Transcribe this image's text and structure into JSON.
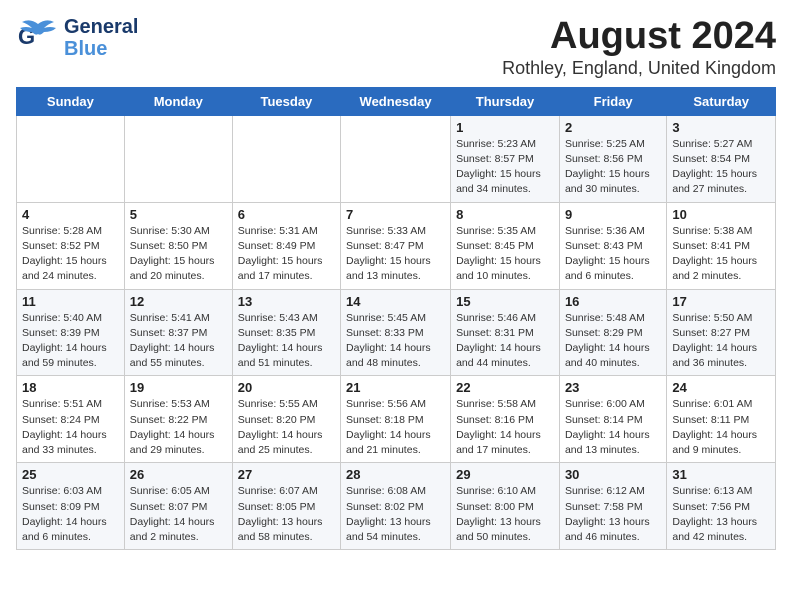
{
  "header": {
    "logo_line1": "General",
    "logo_line2": "Blue",
    "title": "August 2024",
    "subtitle": "Rothley, England, United Kingdom"
  },
  "weekdays": [
    "Sunday",
    "Monday",
    "Tuesday",
    "Wednesday",
    "Thursday",
    "Friday",
    "Saturday"
  ],
  "weeks": [
    [
      {
        "day": "",
        "info": ""
      },
      {
        "day": "",
        "info": ""
      },
      {
        "day": "",
        "info": ""
      },
      {
        "day": "",
        "info": ""
      },
      {
        "day": "1",
        "info": "Sunrise: 5:23 AM\nSunset: 8:57 PM\nDaylight: 15 hours\nand 34 minutes."
      },
      {
        "day": "2",
        "info": "Sunrise: 5:25 AM\nSunset: 8:56 PM\nDaylight: 15 hours\nand 30 minutes."
      },
      {
        "day": "3",
        "info": "Sunrise: 5:27 AM\nSunset: 8:54 PM\nDaylight: 15 hours\nand 27 minutes."
      }
    ],
    [
      {
        "day": "4",
        "info": "Sunrise: 5:28 AM\nSunset: 8:52 PM\nDaylight: 15 hours\nand 24 minutes."
      },
      {
        "day": "5",
        "info": "Sunrise: 5:30 AM\nSunset: 8:50 PM\nDaylight: 15 hours\nand 20 minutes."
      },
      {
        "day": "6",
        "info": "Sunrise: 5:31 AM\nSunset: 8:49 PM\nDaylight: 15 hours\nand 17 minutes."
      },
      {
        "day": "7",
        "info": "Sunrise: 5:33 AM\nSunset: 8:47 PM\nDaylight: 15 hours\nand 13 minutes."
      },
      {
        "day": "8",
        "info": "Sunrise: 5:35 AM\nSunset: 8:45 PM\nDaylight: 15 hours\nand 10 minutes."
      },
      {
        "day": "9",
        "info": "Sunrise: 5:36 AM\nSunset: 8:43 PM\nDaylight: 15 hours\nand 6 minutes."
      },
      {
        "day": "10",
        "info": "Sunrise: 5:38 AM\nSunset: 8:41 PM\nDaylight: 15 hours\nand 2 minutes."
      }
    ],
    [
      {
        "day": "11",
        "info": "Sunrise: 5:40 AM\nSunset: 8:39 PM\nDaylight: 14 hours\nand 59 minutes."
      },
      {
        "day": "12",
        "info": "Sunrise: 5:41 AM\nSunset: 8:37 PM\nDaylight: 14 hours\nand 55 minutes."
      },
      {
        "day": "13",
        "info": "Sunrise: 5:43 AM\nSunset: 8:35 PM\nDaylight: 14 hours\nand 51 minutes."
      },
      {
        "day": "14",
        "info": "Sunrise: 5:45 AM\nSunset: 8:33 PM\nDaylight: 14 hours\nand 48 minutes."
      },
      {
        "day": "15",
        "info": "Sunrise: 5:46 AM\nSunset: 8:31 PM\nDaylight: 14 hours\nand 44 minutes."
      },
      {
        "day": "16",
        "info": "Sunrise: 5:48 AM\nSunset: 8:29 PM\nDaylight: 14 hours\nand 40 minutes."
      },
      {
        "day": "17",
        "info": "Sunrise: 5:50 AM\nSunset: 8:27 PM\nDaylight: 14 hours\nand 36 minutes."
      }
    ],
    [
      {
        "day": "18",
        "info": "Sunrise: 5:51 AM\nSunset: 8:24 PM\nDaylight: 14 hours\nand 33 minutes."
      },
      {
        "day": "19",
        "info": "Sunrise: 5:53 AM\nSunset: 8:22 PM\nDaylight: 14 hours\nand 29 minutes."
      },
      {
        "day": "20",
        "info": "Sunrise: 5:55 AM\nSunset: 8:20 PM\nDaylight: 14 hours\nand 25 minutes."
      },
      {
        "day": "21",
        "info": "Sunrise: 5:56 AM\nSunset: 8:18 PM\nDaylight: 14 hours\nand 21 minutes."
      },
      {
        "day": "22",
        "info": "Sunrise: 5:58 AM\nSunset: 8:16 PM\nDaylight: 14 hours\nand 17 minutes."
      },
      {
        "day": "23",
        "info": "Sunrise: 6:00 AM\nSunset: 8:14 PM\nDaylight: 14 hours\nand 13 minutes."
      },
      {
        "day": "24",
        "info": "Sunrise: 6:01 AM\nSunset: 8:11 PM\nDaylight: 14 hours\nand 9 minutes."
      }
    ],
    [
      {
        "day": "25",
        "info": "Sunrise: 6:03 AM\nSunset: 8:09 PM\nDaylight: 14 hours\nand 6 minutes."
      },
      {
        "day": "26",
        "info": "Sunrise: 6:05 AM\nSunset: 8:07 PM\nDaylight: 14 hours\nand 2 minutes."
      },
      {
        "day": "27",
        "info": "Sunrise: 6:07 AM\nSunset: 8:05 PM\nDaylight: 13 hours\nand 58 minutes."
      },
      {
        "day": "28",
        "info": "Sunrise: 6:08 AM\nSunset: 8:02 PM\nDaylight: 13 hours\nand 54 minutes."
      },
      {
        "day": "29",
        "info": "Sunrise: 6:10 AM\nSunset: 8:00 PM\nDaylight: 13 hours\nand 50 minutes."
      },
      {
        "day": "30",
        "info": "Sunrise: 6:12 AM\nSunset: 7:58 PM\nDaylight: 13 hours\nand 46 minutes."
      },
      {
        "day": "31",
        "info": "Sunrise: 6:13 AM\nSunset: 7:56 PM\nDaylight: 13 hours\nand 42 minutes."
      }
    ]
  ]
}
